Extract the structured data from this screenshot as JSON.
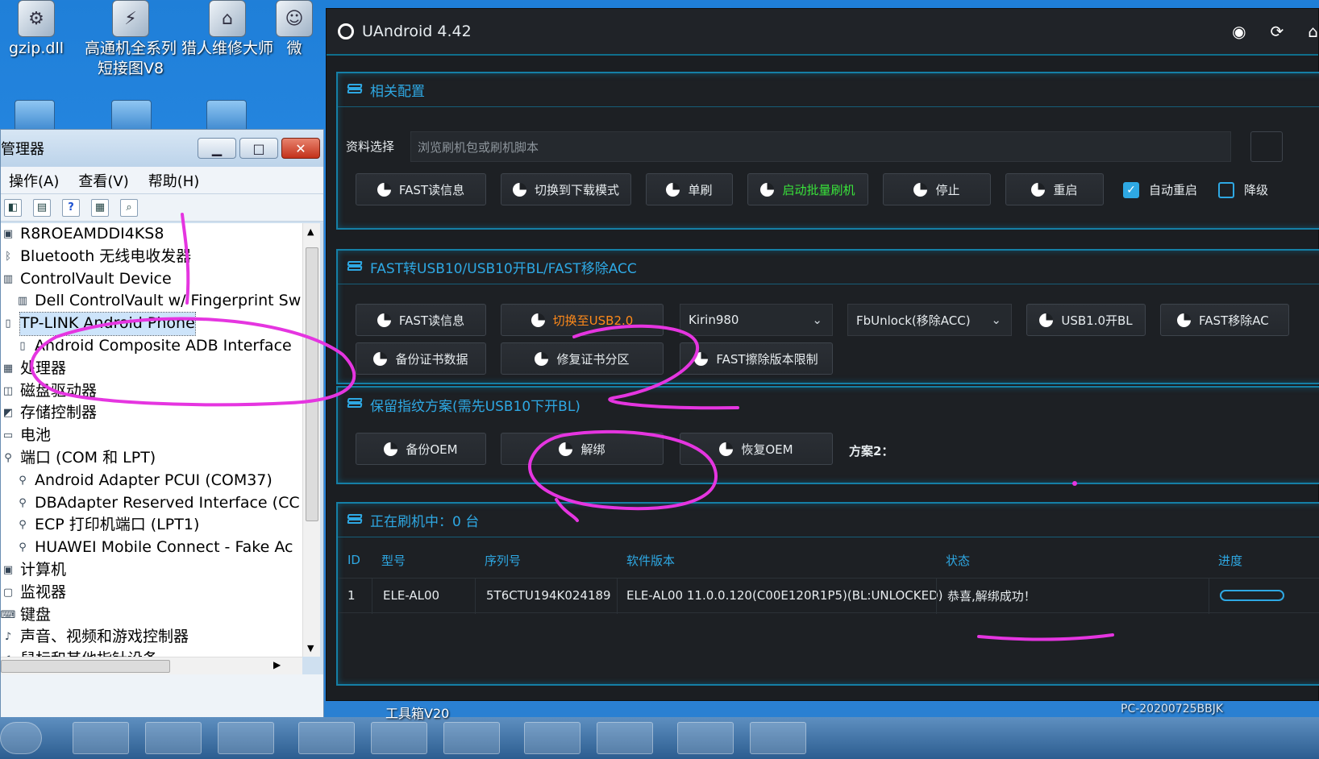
{
  "desktop": {
    "icons": [
      {
        "label": "gzip.dll",
        "glyph": "⚙"
      },
      {
        "label": "高通机全系列短接图V8",
        "glyph": "⚡"
      },
      {
        "label": "猎人维修大师",
        "glyph": "⌂"
      },
      {
        "label": "微",
        "glyph": "☺"
      }
    ]
  },
  "device_manager": {
    "title": "管理器",
    "menu": [
      "操作(A)",
      "查看(V)",
      "帮助(H)"
    ],
    "tree": [
      {
        "label": "R8ROEAMDDI4KS8",
        "level": 0,
        "icon": "computer-icon"
      },
      {
        "label": "Bluetooth 无线电收发器",
        "level": 0,
        "icon": "bluetooth-icon"
      },
      {
        "label": "ControlVault Device",
        "level": 0,
        "icon": "device-icon"
      },
      {
        "label": "Dell ControlVault w/ Fingerprint Sw",
        "level": 1,
        "icon": "device-icon"
      },
      {
        "label": "TP-LINK Android Phone",
        "level": 0,
        "icon": "phone-icon"
      },
      {
        "label": "Android Composite ADB Interface",
        "level": 1,
        "icon": "phone-icon"
      },
      {
        "label": "处理器",
        "level": 0,
        "icon": "cpu-icon"
      },
      {
        "label": "磁盘驱动器",
        "level": 0,
        "icon": "disk-icon"
      },
      {
        "label": "存储控制器",
        "level": 0,
        "icon": "storage-icon"
      },
      {
        "label": "电池",
        "level": 0,
        "icon": "battery-icon"
      },
      {
        "label": "端口 (COM 和 LPT)",
        "level": 0,
        "icon": "port-icon"
      },
      {
        "label": "Android Adapter PCUI (COM37)",
        "level": 1,
        "icon": "port-icon"
      },
      {
        "label": "DBAdapter Reserved Interface (CC",
        "level": 1,
        "icon": "port-icon"
      },
      {
        "label": "ECP 打印机端口 (LPT1)",
        "level": 1,
        "icon": "port-icon"
      },
      {
        "label": "HUAWEI Mobile Connect - Fake Ac",
        "level": 1,
        "icon": "port-icon"
      },
      {
        "label": "计算机",
        "level": 0,
        "icon": "computer-icon"
      },
      {
        "label": "监视器",
        "level": 0,
        "icon": "monitor-icon"
      },
      {
        "label": "键盘",
        "level": 0,
        "icon": "keyboard-icon"
      },
      {
        "label": "声音、视频和游戏控制器",
        "level": 0,
        "icon": "sound-icon"
      },
      {
        "label": "鼠标和其他指针设备",
        "level": 0,
        "icon": "mouse-icon"
      }
    ],
    "selected_index": 4
  },
  "uandroid": {
    "title": "UAndroid 4.42",
    "config_panel": {
      "title": "相关配置",
      "file_label": "资料选择",
      "file_placeholder": "浏览刷机包或刷机脚本",
      "buttons": [
        "FAST读信息",
        "切换到下载模式",
        "单刷",
        "启动批量刷机",
        "停止",
        "重启"
      ],
      "auto_reboot_label": "自动重启",
      "auto_reboot_checked": true,
      "extra_label": "降级"
    },
    "fast_panel": {
      "title": "FAST转USB10/USB10开BL/FAST移除ACC",
      "buttons_row1": [
        "FAST读信息",
        "切换至USB2.0"
      ],
      "chip_select": "Kirin980",
      "unlock_select": "FbUnlock(移除ACC)",
      "buttons_row1_tail": [
        "USB1.0开BL",
        "FAST移除AC"
      ],
      "buttons_row2": [
        "备份证书数据",
        "修复证书分区",
        "FAST擦除版本限制"
      ]
    },
    "fingerprint_panel": {
      "title": "保留指纹方案(需先USB10下开BL)",
      "buttons": [
        "备份OEM",
        "解绑",
        "恢复OEM"
      ],
      "plan_label": "方案2："
    },
    "flashing_panel": {
      "title": "正在刷机中：0 台",
      "columns": [
        "ID",
        "型号",
        "序列号",
        "软件版本",
        "状态",
        "进度"
      ],
      "rows": [
        {
          "id": "1",
          "model": "ELE-AL00",
          "serial": "5T6CTU194K024189",
          "version": "ELE-AL00 11.0.0.120(C00E120R1P5)(BL:UNLOCKED)",
          "status": "恭喜,解绑成功！"
        }
      ]
    }
  },
  "taskbar": {
    "labels": [
      "工具箱V20",
      "PC-20200725BBJK"
    ]
  },
  "colors": {
    "accent": "#2ea8e3",
    "annotation": "#e535e0",
    "green_button": "#39e33a"
  }
}
